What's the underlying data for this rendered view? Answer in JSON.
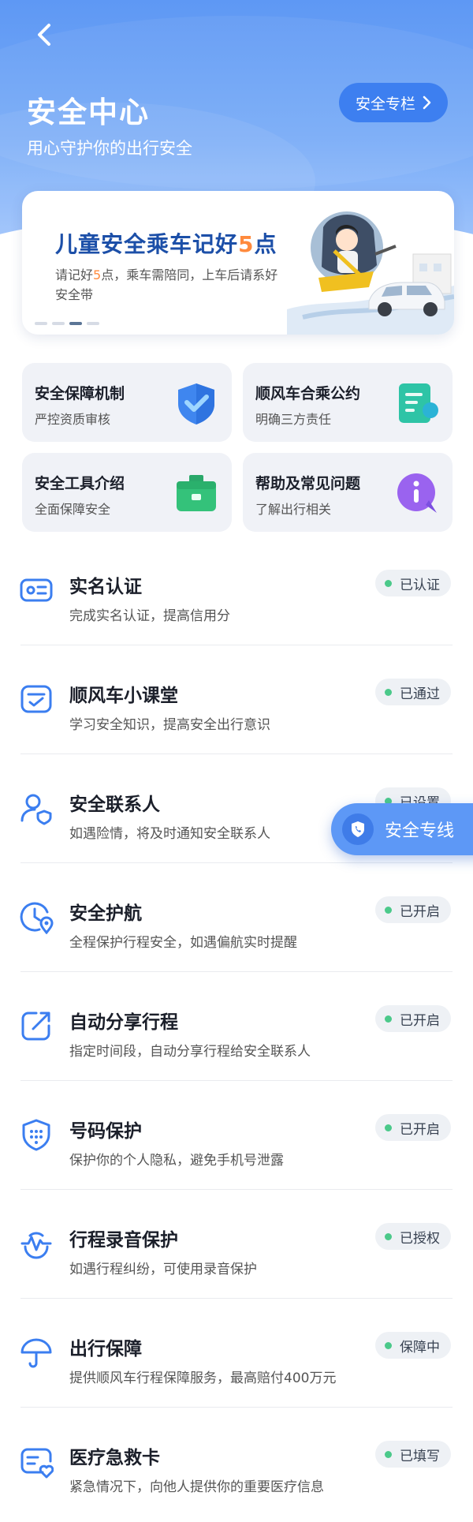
{
  "header": {
    "title": "安全中心",
    "subtitle": "用心守护你的出行安全",
    "column_button": "安全专栏"
  },
  "banner": {
    "title_main": "儿童安全乘车记好",
    "title_num": "5",
    "title_end": "点",
    "desc_a": "请记好",
    "desc_num": "5",
    "desc_b": "点，乘车需陪同，上车后请系好安全带"
  },
  "tiles": [
    {
      "title": "安全保障机制",
      "sub": "严控资质审核",
      "icon": "shield-check-icon"
    },
    {
      "title": "顺风车合乘公约",
      "sub": "明确三方责任",
      "icon": "document-icon"
    },
    {
      "title": "安全工具介绍",
      "sub": "全面保障安全",
      "icon": "toolbox-icon"
    },
    {
      "title": "帮助及常见问题",
      "sub": "了解出行相关",
      "icon": "info-bubble-icon"
    }
  ],
  "items": [
    {
      "title": "实名认证",
      "sub": "完成实名认证，提高信用分",
      "status": "已认证",
      "icon": "id-card-icon"
    },
    {
      "title": "顺风车小课堂",
      "sub": "学习安全知识，提高安全出行意识",
      "status": "已通过",
      "icon": "classroom-icon"
    },
    {
      "title": "安全联系人",
      "sub": "如遇险情，将及时通知安全联系人",
      "status": "已设置",
      "icon": "contact-shield-icon"
    },
    {
      "title": "安全护航",
      "sub": "全程保护行程安全，如遇偏航实时提醒",
      "status": "已开启",
      "icon": "clock-location-icon"
    },
    {
      "title": "自动分享行程",
      "sub": "指定时间段，自动分享行程给安全联系人",
      "status": "已开启",
      "icon": "share-icon"
    },
    {
      "title": "号码保护",
      "sub": "保护你的个人隐私，避免手机号泄露",
      "status": "已开启",
      "icon": "number-shield-icon"
    },
    {
      "title": "行程录音保护",
      "sub": "如遇行程纠纷，可使用录音保护",
      "status": "已授权",
      "icon": "audio-wave-icon"
    },
    {
      "title": "出行保障",
      "sub": "提供顺风车行程保障服务，最高赔付400万元",
      "status": "保障中",
      "icon": "umbrella-icon"
    },
    {
      "title": "医疗急救卡",
      "sub": "紧急情况下，向他人提供你的重要医疗信息",
      "status": "已填写",
      "icon": "medical-card-icon"
    }
  ],
  "float_button": "安全专线"
}
